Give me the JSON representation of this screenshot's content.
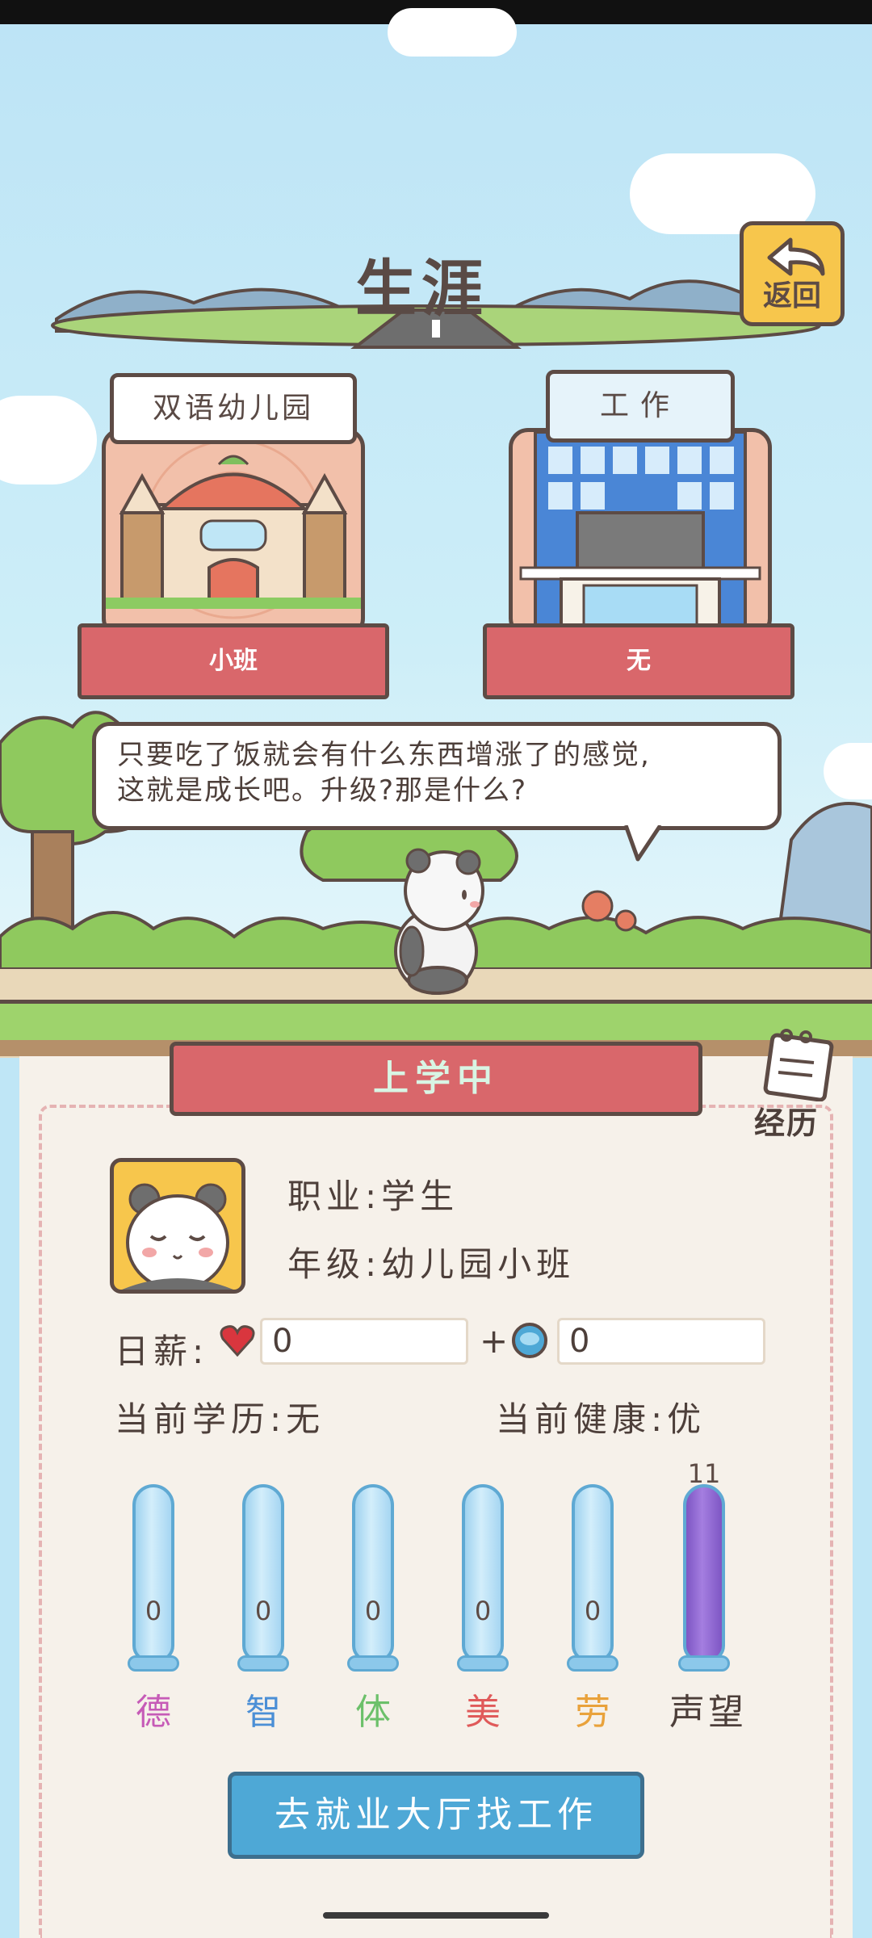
{
  "screen": {
    "title": "生涯",
    "back_label": "返回"
  },
  "cards": {
    "school": {
      "sign": "双语幼儿园",
      "ribbon": "小班"
    },
    "work": {
      "sign": "工作",
      "ribbon": "无"
    }
  },
  "speech_bubble": {
    "line1": "只要吃了饭就会有什么东西增涨了的感觉,",
    "line2": "这就是成长吧。升级?那是什么?"
  },
  "status_ribbon": "上学中",
  "history_label": "经历",
  "profile": {
    "job_label": "职业:",
    "job_value": "学生",
    "grade_label": "年级:",
    "grade_value": "幼儿园小班"
  },
  "salary": {
    "label": "日薪:",
    "heart_value": "0",
    "plus": "+",
    "coin_value": "0"
  },
  "education": {
    "label": "当前学历:",
    "value": "无"
  },
  "health": {
    "label": "当前健康:",
    "value": "优"
  },
  "attributes": [
    {
      "name": "德",
      "value": "0",
      "color": "#c65bb7"
    },
    {
      "name": "智",
      "value": "0",
      "color": "#4b8fd6"
    },
    {
      "name": "体",
      "value": "0",
      "color": "#6cc06a"
    },
    {
      "name": "美",
      "value": "0",
      "color": "#e05a5a"
    },
    {
      "name": "劳",
      "value": "0",
      "color": "#e9a23b"
    },
    {
      "name": "声望",
      "value": "11",
      "color": "#4d3f3a"
    }
  ],
  "job_button": "去就业大厅找工作",
  "colors": {
    "ribbon": "#d9676b",
    "button": "#4ea8d6",
    "outline": "#5d4b45",
    "fame_fill": "#9b6fd6"
  }
}
